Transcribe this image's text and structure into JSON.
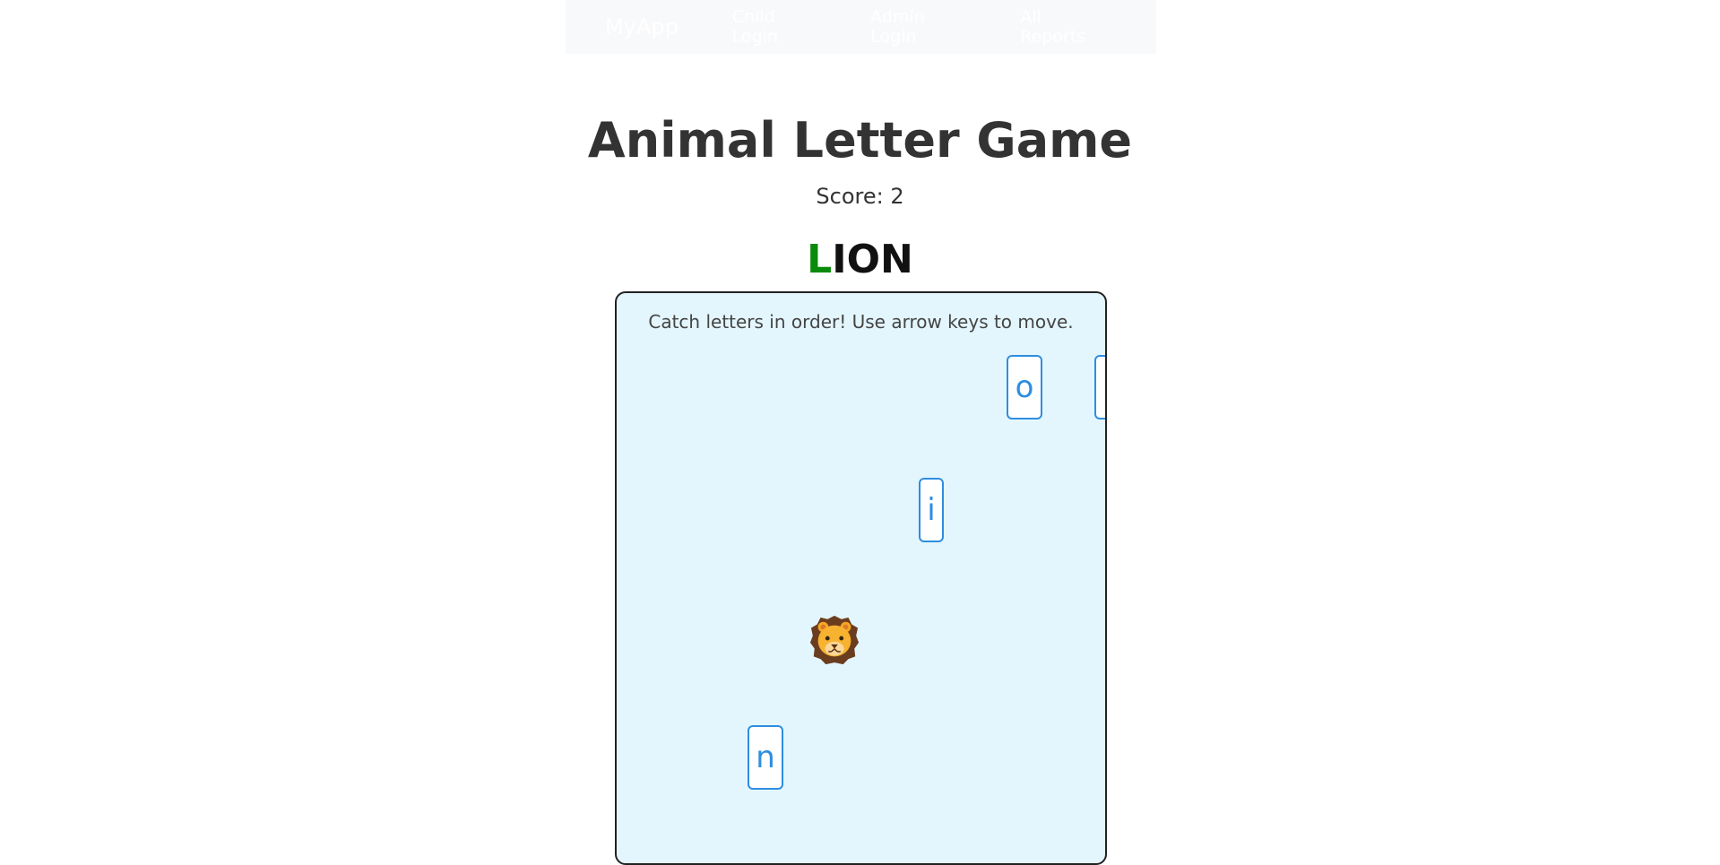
{
  "nav": {
    "brand": "MyApp",
    "links": [
      "Child Login",
      "Admin Login",
      "All Reports"
    ]
  },
  "game": {
    "title": "Animal Letter Game",
    "score_text": "Score: 2",
    "target_word": {
      "caught": "L",
      "remaining": "ION"
    },
    "instructions": "Catch letters in order! Use arrow keys to move.",
    "falling_letters": [
      "o",
      "n",
      "i",
      "n"
    ],
    "player_icon": "lion-face-icon",
    "colors": {
      "caught_letter": "#0a8a0a",
      "letter_tile": "#2e8ee0",
      "play_area_bg": "#e3f6fd"
    }
  }
}
